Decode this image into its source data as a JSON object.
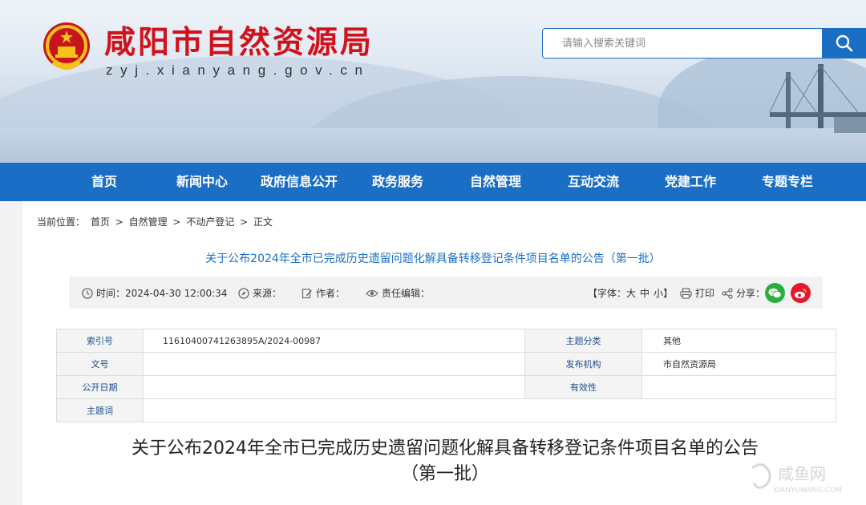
{
  "header": {
    "site_title": "咸阳市自然资源局",
    "site_domain": "zyj.xianyang.gov.cn",
    "search_placeholder": "请输入搜索关键词"
  },
  "nav": {
    "items": [
      "首页",
      "新闻中心",
      "政府信息公开",
      "政务服务",
      "自然管理",
      "互动交流",
      "党建工作",
      "专题专栏"
    ]
  },
  "breadcrumb": {
    "prefix": "当前位置：",
    "items": [
      "首页",
      "自然管理",
      "不动产登记",
      "正文"
    ],
    "separator": ">"
  },
  "article": {
    "page_title": "关于公布2024年全市已完成历史遗留问题化解具备转移登记条件项目名单的公告（第一批）",
    "meta": {
      "time_label": "时间：",
      "time_value": "2024-04-30 12:00:34",
      "source_label": "来源：",
      "author_label": "作者：",
      "editor_label": "责任编辑：",
      "font_label": "【字体：",
      "font_large": "大",
      "font_medium": "中",
      "font_small": "小",
      "font_close": "】",
      "print_label": "打印",
      "share_label": "分享："
    },
    "doc_title_line1": "关于公布2024年全市已完成历史遗留问题化解具备转移登记条件项目名单的公告",
    "doc_title_line2": "（第一批）"
  },
  "info_table": {
    "index_label": "索引号",
    "index_value": "11610400741263895A/2024-00987",
    "topic_label": "主题分类",
    "topic_value": "其他",
    "docno_label": "文号",
    "docno_value": "",
    "publisher_label": "发布机构",
    "publisher_value": "市自然资源局",
    "date_label": "公开日期",
    "date_value": "",
    "validity_label": "有效性",
    "validity_value": "",
    "keywords_label": "主题词",
    "keywords_value": ""
  },
  "watermark": {
    "name": "咸鱼网",
    "domain": "XIANYUWANG.COM"
  },
  "colors": {
    "brand_red": "#d0121b",
    "nav_blue": "#1a6fc4",
    "wechat_green": "#2aae3c",
    "weibo_red": "#e6162d"
  }
}
